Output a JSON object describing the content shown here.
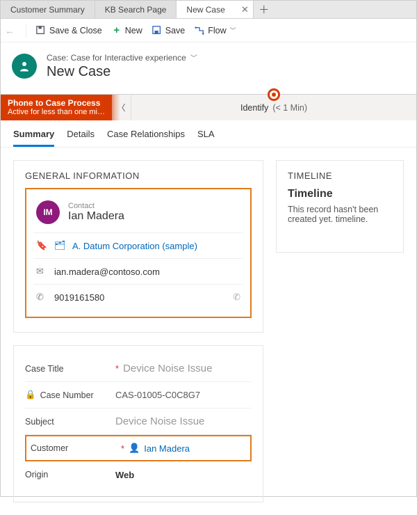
{
  "tabs": {
    "items": [
      {
        "label": "Customer Summary"
      },
      {
        "label": "KB Search Page"
      },
      {
        "label": "New Case"
      }
    ]
  },
  "commands": {
    "save_close": "Save & Close",
    "new": "New",
    "save": "Save",
    "flow": "Flow"
  },
  "header": {
    "breadcrumb": "Case: Case for Interactive experience",
    "title": "New Case"
  },
  "process": {
    "name": "Phone to Case Process",
    "status": "Active for less than one mi…",
    "stage": "Identify",
    "stage_time": "(< 1 Min)"
  },
  "form_tabs": [
    "Summary",
    "Details",
    "Case Relationships",
    "SLA"
  ],
  "general": {
    "title": "GENERAL INFORMATION",
    "contact_label": "Contact",
    "contact_name": "Ian Madera",
    "contact_initials": "IM",
    "company": "A. Datum Corporation (sample)",
    "email": "ian.madera@contoso.com",
    "phone": "9019161580"
  },
  "fields": {
    "case_title_label": "Case Title",
    "case_title_value": "Device Noise Issue",
    "case_number_label": "Case Number",
    "case_number_value": "CAS-01005-C0C8G7",
    "subject_label": "Subject",
    "subject_value": "Device Noise Issue",
    "customer_label": "Customer",
    "customer_value": "Ian Madera",
    "origin_label": "Origin",
    "origin_value": "Web"
  },
  "timeline": {
    "section": "TIMELINE",
    "title": "Timeline",
    "empty": "This record hasn't been created yet. timeline."
  }
}
